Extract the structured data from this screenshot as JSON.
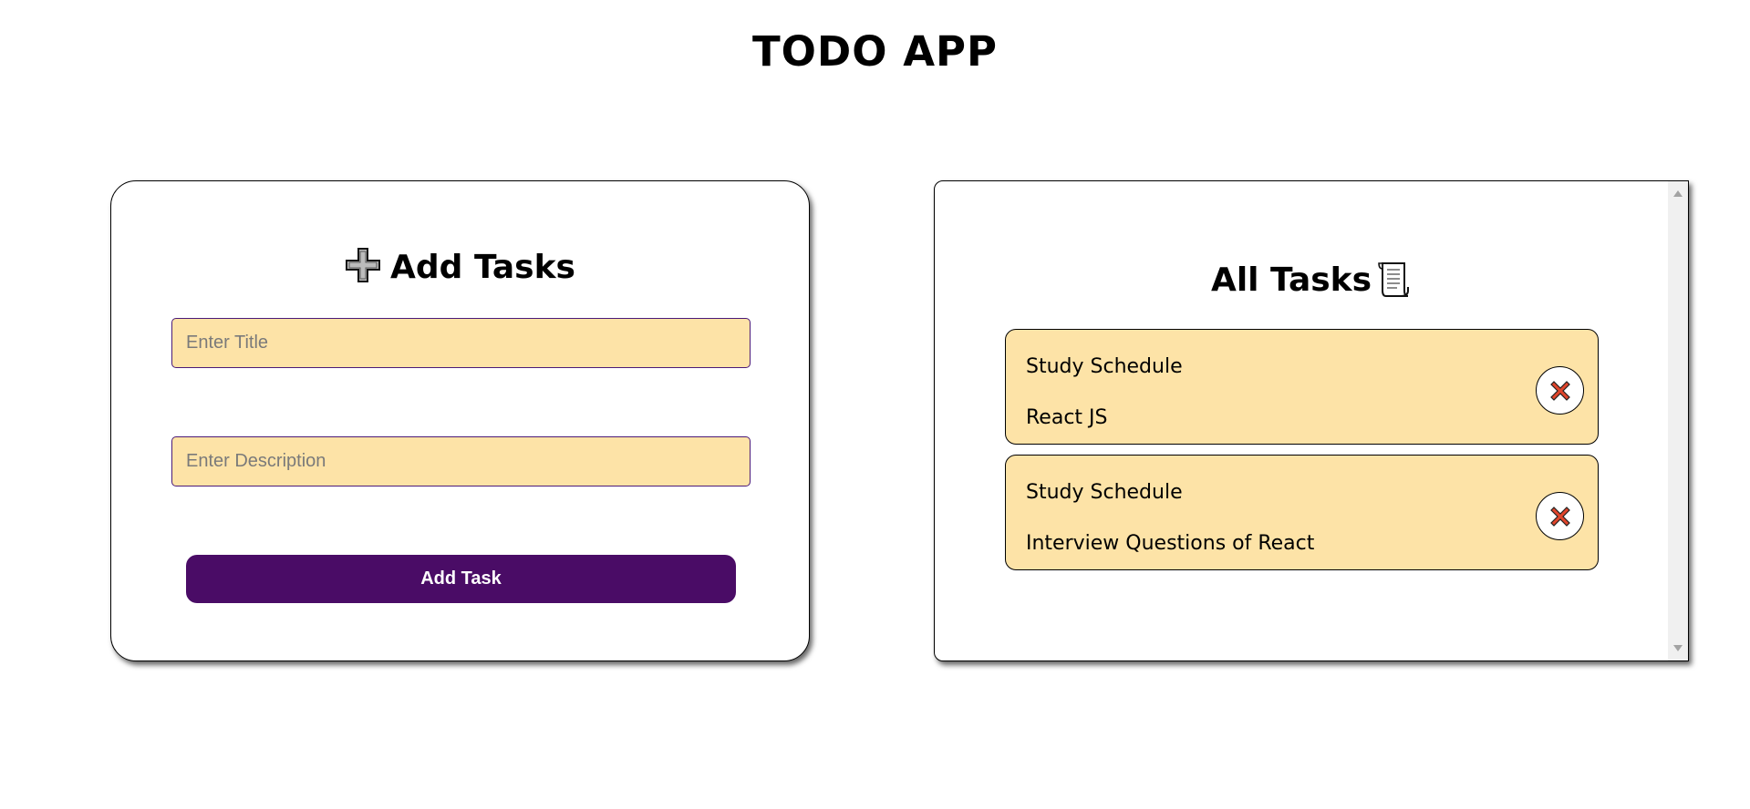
{
  "app": {
    "title": "TODO APP"
  },
  "add_panel": {
    "heading": "Add Tasks",
    "heading_icon": "plus-icon",
    "title_placeholder": "Enter Title",
    "title_value": "",
    "description_placeholder": "Enter Description",
    "description_value": "",
    "add_button_label": "Add Task"
  },
  "list_panel": {
    "heading": "All Tasks",
    "heading_icon": "scroll-icon",
    "tasks": [
      {
        "title": "Study Schedule",
        "description": "React JS",
        "delete_icon": "close-icon"
      },
      {
        "title": "Study Schedule",
        "description": "Interview Questions of React",
        "delete_icon": "close-icon"
      }
    ]
  },
  "colors": {
    "field_background": "#fde3a7",
    "field_border": "#4a1a78",
    "button_background": "#4a0c66",
    "button_text": "#ffffff",
    "delete_icon": "#e0452b"
  }
}
